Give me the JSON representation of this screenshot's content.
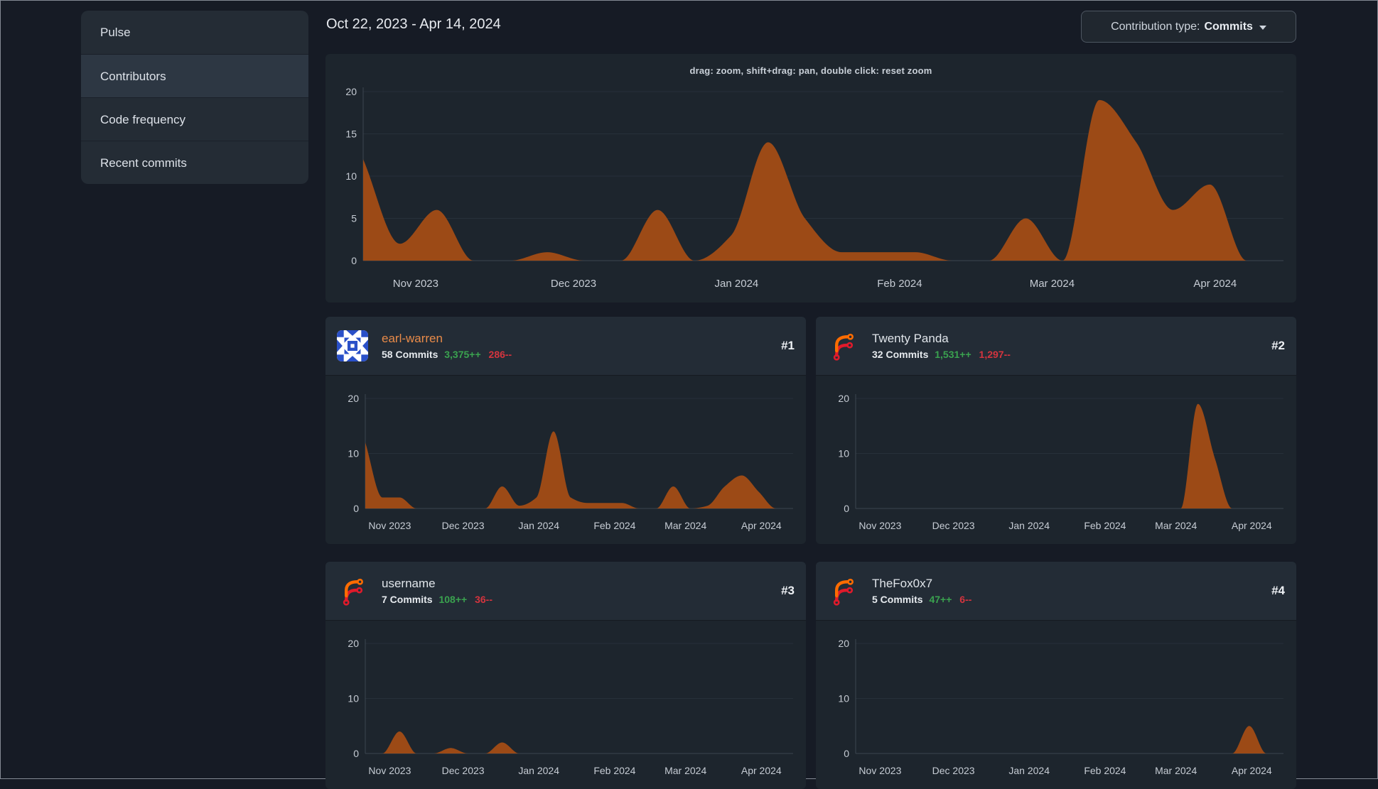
{
  "sidebar": {
    "items": [
      {
        "label": "Pulse",
        "active": false
      },
      {
        "label": "Contributors",
        "active": true
      },
      {
        "label": "Code frequency",
        "active": false
      },
      {
        "label": "Recent commits",
        "active": false
      }
    ]
  },
  "header": {
    "date_range": "Oct 22, 2023 - Apr 14, 2024"
  },
  "toolbar": {
    "contribution_type_label": "Contribution type:",
    "contribution_type_value": "Commits"
  },
  "main_chart": {
    "hint": "drag: zoom, shift+drag: pan, double click: reset zoom"
  },
  "contributors": [
    {
      "rank": "#1",
      "name": "earl-warren",
      "commits": "58 Commits",
      "additions": "3,375++",
      "deletions": "286--",
      "avatar": "blue-identicon"
    },
    {
      "rank": "#2",
      "name": "Twenty Panda",
      "commits": "32 Commits",
      "additions": "1,531++",
      "deletions": "1,297--",
      "avatar": "forgejo-logo"
    },
    {
      "rank": "#3",
      "name": "username",
      "commits": "7 Commits",
      "additions": "108++",
      "deletions": "36--",
      "avatar": "forgejo-logo"
    },
    {
      "rank": "#4",
      "name": "TheFox0x7",
      "commits": "5 Commits",
      "additions": "47++",
      "deletions": "6--",
      "avatar": "forgejo-logo"
    }
  ],
  "colors": {
    "area_fill": "#9c4a16",
    "link_orange": "#e98b49",
    "additions_green": "#3aa24f",
    "deletions_red": "#d4343e",
    "axis_text": "#c6ccd4",
    "grid_line": "#27303a",
    "axis_line": "#3c4550"
  },
  "chart_data": [
    {
      "id": "overall-commit-frequency",
      "type": "area",
      "x_unit": "week",
      "x_range": [
        "Oct 22, 2023",
        "Apr 14, 2024"
      ],
      "x_tick_labels": [
        "Nov 2023",
        "Dec 2023",
        "Jan 2024",
        "Feb 2024",
        "Mar 2024",
        "Apr 2024"
      ],
      "x_tick_fractions": [
        0.0571,
        0.2286,
        0.4057,
        0.5829,
        0.7486,
        0.9257
      ],
      "yticks": [
        0,
        5,
        10,
        15,
        20
      ],
      "ylim": [
        0,
        20
      ],
      "grid": true,
      "legend": "none",
      "values": [
        12,
        2,
        6,
        0,
        0,
        1,
        0,
        0,
        6,
        0,
        3,
        14,
        5,
        1,
        1,
        1,
        0,
        0,
        5,
        0,
        19,
        14,
        6,
        9,
        0,
        0
      ],
      "fill": "#9c4a16"
    },
    {
      "id": "earl-warren-commits",
      "type": "area",
      "x_unit": "week",
      "x_range": [
        "Oct 22, 2023",
        "Apr 14, 2024"
      ],
      "x_tick_labels": [
        "Nov 2023",
        "Dec 2023",
        "Jan 2024",
        "Feb 2024",
        "Mar 2024",
        "Apr 2024"
      ],
      "x_tick_fractions": [
        0.0571,
        0.2286,
        0.4057,
        0.5829,
        0.7486,
        0.9257
      ],
      "yticks": [
        0,
        10,
        20
      ],
      "ylim": [
        0,
        20
      ],
      "grid": true,
      "legend": "none",
      "values": [
        12,
        2,
        2,
        0,
        0,
        0,
        0,
        0,
        4,
        0.5,
        2,
        14,
        2,
        1,
        1,
        1,
        0,
        0,
        4,
        0,
        0.5,
        4,
        6,
        3,
        0,
        0
      ],
      "fill": "#9c4a16"
    },
    {
      "id": "twenty-panda-commits",
      "type": "area",
      "x_unit": "week",
      "x_range": [
        "Oct 22, 2023",
        "Apr 14, 2024"
      ],
      "x_tick_labels": [
        "Nov 2023",
        "Dec 2023",
        "Jan 2024",
        "Feb 2024",
        "Mar 2024",
        "Apr 2024"
      ],
      "x_tick_fractions": [
        0.0571,
        0.2286,
        0.4057,
        0.5829,
        0.7486,
        0.9257
      ],
      "yticks": [
        0,
        10,
        20
      ],
      "ylim": [
        0,
        20
      ],
      "grid": true,
      "legend": "none",
      "values": [
        0,
        0,
        0,
        0,
        0,
        0,
        0,
        0,
        0,
        0,
        0,
        0,
        0,
        0,
        0,
        0,
        0,
        0,
        0,
        0,
        19,
        9,
        0,
        0,
        0,
        0
      ],
      "fill": "#9c4a16"
    },
    {
      "id": "username-commits",
      "type": "area",
      "x_unit": "week",
      "x_range": [
        "Oct 22, 2023",
        "Apr 14, 2024"
      ],
      "x_tick_labels": [
        "Nov 2023",
        "Dec 2023",
        "Jan 2024",
        "Feb 2024",
        "Mar 2024",
        "Apr 2024"
      ],
      "x_tick_fractions": [
        0.0571,
        0.2286,
        0.4057,
        0.5829,
        0.7486,
        0.9257
      ],
      "yticks": [
        0,
        10,
        20
      ],
      "ylim": [
        0,
        20
      ],
      "grid": true,
      "legend": "none",
      "values": [
        0,
        0,
        4,
        0,
        0,
        1,
        0,
        0,
        2,
        0,
        0,
        0,
        0,
        0,
        0,
        0,
        0,
        0,
        0,
        0,
        0,
        0,
        0,
        0,
        0,
        0
      ],
      "fill": "#9c4a16"
    },
    {
      "id": "thefox0x7-commits",
      "type": "area",
      "x_unit": "week",
      "x_range": [
        "Oct 22, 2023",
        "Apr 14, 2024"
      ],
      "x_tick_labels": [
        "Nov 2023",
        "Dec 2023",
        "Jan 2024",
        "Feb 2024",
        "Mar 2024",
        "Apr 2024"
      ],
      "x_tick_fractions": [
        0.0571,
        0.2286,
        0.4057,
        0.5829,
        0.7486,
        0.9257
      ],
      "yticks": [
        0,
        10,
        20
      ],
      "ylim": [
        0,
        20
      ],
      "grid": true,
      "legend": "none",
      "values": [
        0,
        0,
        0,
        0,
        0,
        0,
        0,
        0,
        0,
        0,
        0,
        0,
        0,
        0,
        0,
        0,
        0,
        0,
        0,
        0,
        0,
        0,
        0,
        5,
        0,
        0
      ],
      "fill": "#9c4a16"
    }
  ]
}
